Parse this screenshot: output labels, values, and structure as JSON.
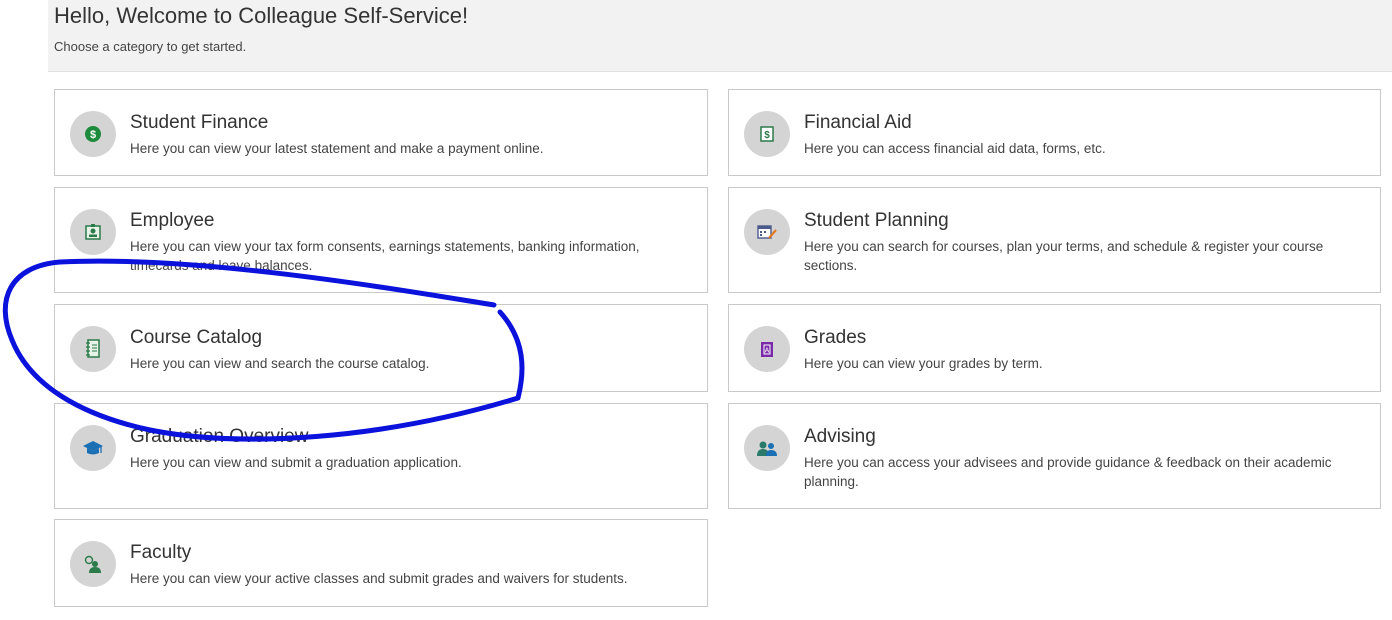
{
  "header": {
    "title": "Hello, Welcome to Colleague Self-Service!",
    "subtitle": "Choose a category to get started."
  },
  "cards": [
    {
      "title": "Student Finance",
      "description": "Here you can view your latest statement and make a payment online.",
      "icon": "dollar-coin-icon"
    },
    {
      "title": "Financial Aid",
      "description": "Here you can access financial aid data, forms, etc.",
      "icon": "money-document-icon"
    },
    {
      "title": "Employee",
      "description": "Here you can view your tax form consents, earnings statements, banking information, timecards and leave balances.",
      "icon": "id-badge-icon"
    },
    {
      "title": "Student Planning",
      "description": "Here you can search for courses, plan your terms, and schedule & register your course sections.",
      "icon": "calendar-pencil-icon"
    },
    {
      "title": "Course Catalog",
      "description": "Here you can view and search the course catalog.",
      "icon": "notebook-icon"
    },
    {
      "title": "Grades",
      "description": "Here you can view your grades by term.",
      "icon": "gradebook-icon"
    },
    {
      "title": "Graduation Overview",
      "description": "Here you can view and submit a graduation application.",
      "icon": "graduation-cap-icon"
    },
    {
      "title": "Advising",
      "description": "Here you can access your advisees and provide guidance & feedback on their academic planning.",
      "icon": "people-icon"
    },
    {
      "title": "Faculty",
      "description": "Here you can view your active classes and submit grades and waivers for students.",
      "icon": "faculty-person-icon"
    }
  ],
  "colors": {
    "annotation_stroke": "#0a12dc",
    "icon_circle": "#d4d4d4",
    "card_border": "#c9c9c9",
    "header_bg": "#f2f2f2"
  }
}
